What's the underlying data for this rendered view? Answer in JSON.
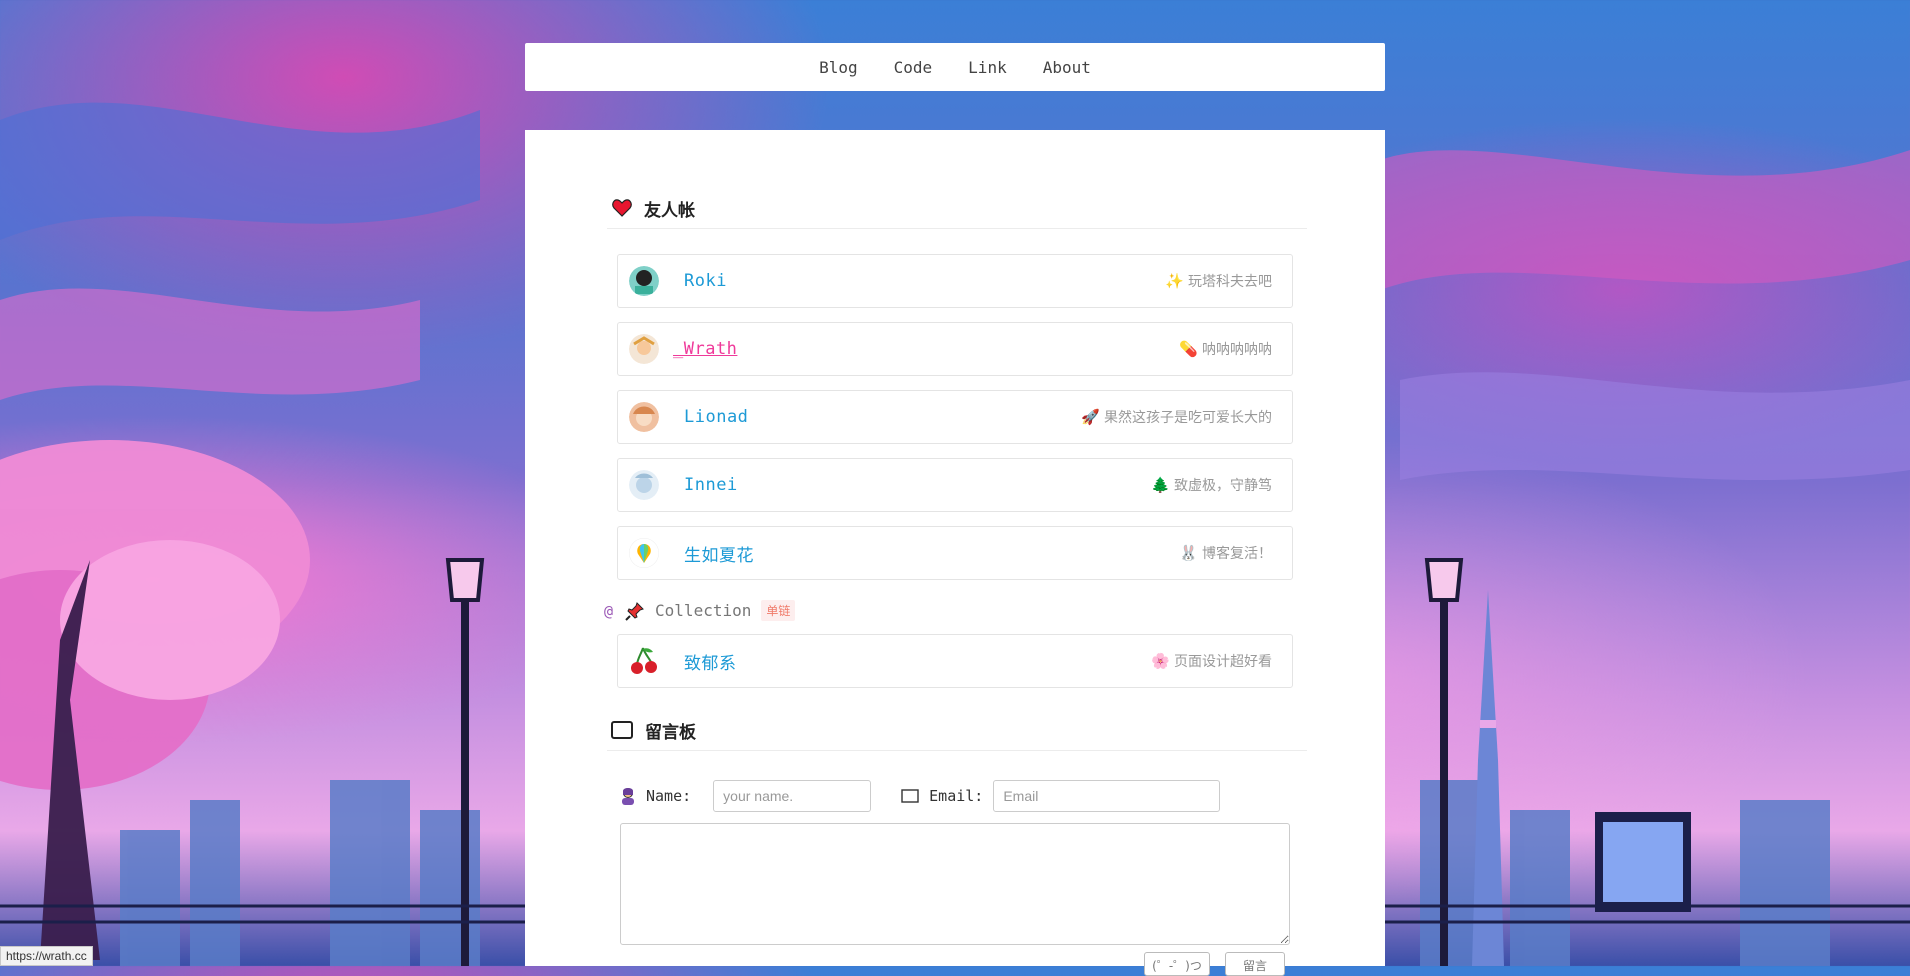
{
  "nav": {
    "items": [
      {
        "label": "Blog"
      },
      {
        "label": "Code"
      },
      {
        "label": "Link"
      },
      {
        "label": "About"
      }
    ]
  },
  "friends": {
    "title": "友人帐",
    "links": [
      {
        "name": "Roki",
        "desc": "玩塔科夫去吧",
        "desc_emoji": "✨"
      },
      {
        "name": "_Wrath",
        "desc": "呐呐呐呐呐",
        "desc_emoji": "💊"
      },
      {
        "name": "Lionad",
        "desc": "果然这孩子是吃可爱长大的",
        "desc_emoji": "🚀"
      },
      {
        "name": "Innei",
        "desc": "致虚极，守静笃",
        "desc_emoji": "🌲"
      },
      {
        "name": "生如夏花",
        "desc": "博客复活！",
        "desc_emoji": "🐰"
      }
    ]
  },
  "collection": {
    "at": "@",
    "label": "Collection",
    "badge": "单链",
    "links": [
      {
        "name": "致郁系",
        "desc": "页面设计超好看",
        "desc_emoji": "🌸"
      }
    ]
  },
  "guestbook": {
    "title": "留言板",
    "name_label": "Name:",
    "name_placeholder": "your name.",
    "email_label": "Email:",
    "email_placeholder": "Email",
    "button1": "(゜-゜)つ",
    "button2": "留言"
  },
  "status_bar": {
    "url": "https://wrath.cc"
  },
  "colors": {
    "link": "#1d9ad6",
    "active_link": "#ef3a9a",
    "muted": "#999999"
  }
}
